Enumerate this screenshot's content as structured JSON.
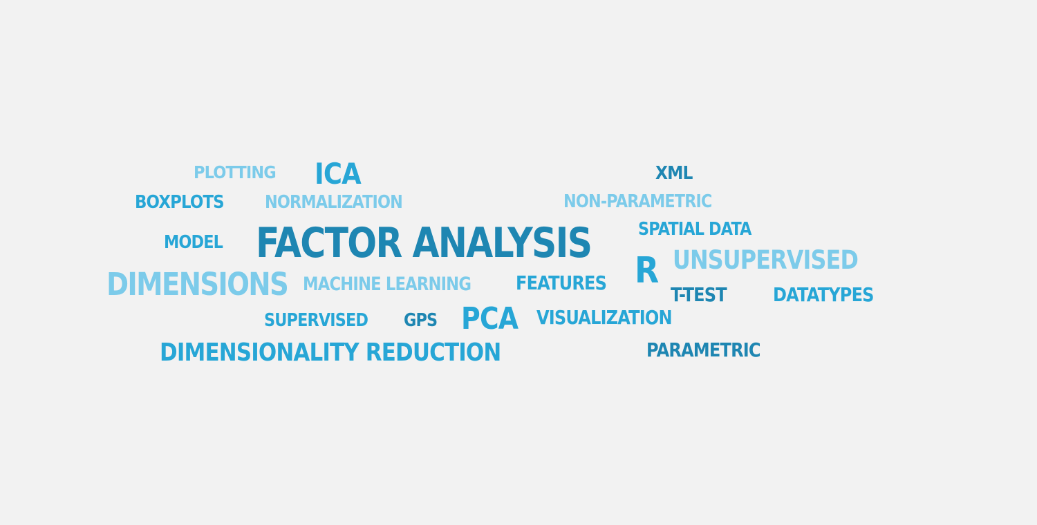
{
  "background_color": "#f2f2f2",
  "palette": {
    "dark": "#1e86b2",
    "mid": "#27a6d6",
    "light": "#7ccbea"
  },
  "words": [
    {
      "text": "PLOTTING",
      "color": "light"
    },
    {
      "text": "ICA",
      "color": "mid"
    },
    {
      "text": "XML",
      "color": "dark"
    },
    {
      "text": "BOXPLOTS",
      "color": "mid"
    },
    {
      "text": "NORMALIZATION",
      "color": "light"
    },
    {
      "text": "NON-PARAMETRIC",
      "color": "light"
    },
    {
      "text": "SPATIAL DATA",
      "color": "mid"
    },
    {
      "text": "MODEL",
      "color": "mid"
    },
    {
      "text": "FACTOR ANALYSIS",
      "color": "dark"
    },
    {
      "text": "R",
      "color": "mid"
    },
    {
      "text": "UNSUPERVISED",
      "color": "light"
    },
    {
      "text": "DIMENSIONS",
      "color": "light"
    },
    {
      "text": "MACHINE LEARNING",
      "color": "light"
    },
    {
      "text": "FEATURES",
      "color": "mid"
    },
    {
      "text": "T-TEST",
      "color": "dark"
    },
    {
      "text": "DATATYPES",
      "color": "mid"
    },
    {
      "text": "SUPERVISED",
      "color": "mid"
    },
    {
      "text": "GPS",
      "color": "dark"
    },
    {
      "text": "PCA",
      "color": "mid"
    },
    {
      "text": "VISUALIZATION",
      "color": "mid"
    },
    {
      "text": "DIMENSIONALITY REDUCTION",
      "color": "mid"
    },
    {
      "text": "PARAMETRIC",
      "color": "dark"
    }
  ]
}
